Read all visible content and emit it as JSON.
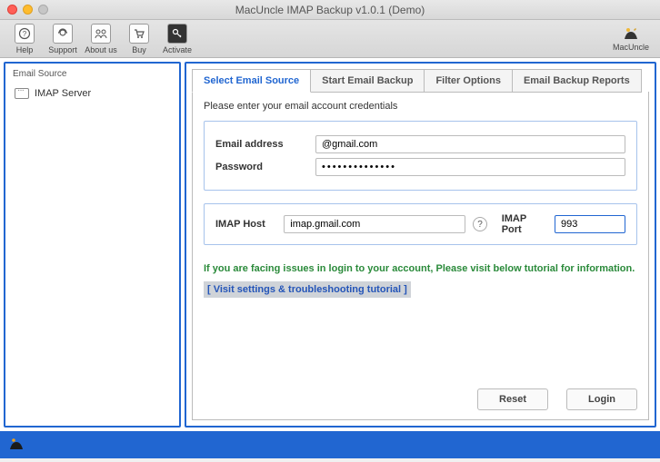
{
  "window": {
    "title": "MacUncle IMAP Backup v1.0.1 (Demo)"
  },
  "toolbar": {
    "help": "Help",
    "support": "Support",
    "about": "About us",
    "buy": "Buy",
    "activate": "Activate",
    "brand": "MacUncle"
  },
  "sidebar": {
    "header": "Email Source",
    "items": [
      {
        "label": "IMAP Server"
      }
    ]
  },
  "tabs": {
    "select": "Select Email Source",
    "start": "Start Email Backup",
    "filter": "Filter Options",
    "reports": "Email Backup Reports"
  },
  "form": {
    "instruction": "Please enter your email account credentials",
    "email_label": "Email address",
    "email_value": "@gmail.com",
    "password_label": "Password",
    "password_value": "••••••••••••••",
    "host_label": "IMAP Host",
    "host_value": "imap.gmail.com",
    "help_symbol": "?",
    "port_label": "IMAP Port",
    "port_value": "993",
    "trouble_msg": "If you are facing issues in login to your account, Please visit below tutorial for information.",
    "trouble_link": "[ Visit settings & troubleshooting tutorial ]",
    "reset": "Reset",
    "login": "Login"
  }
}
